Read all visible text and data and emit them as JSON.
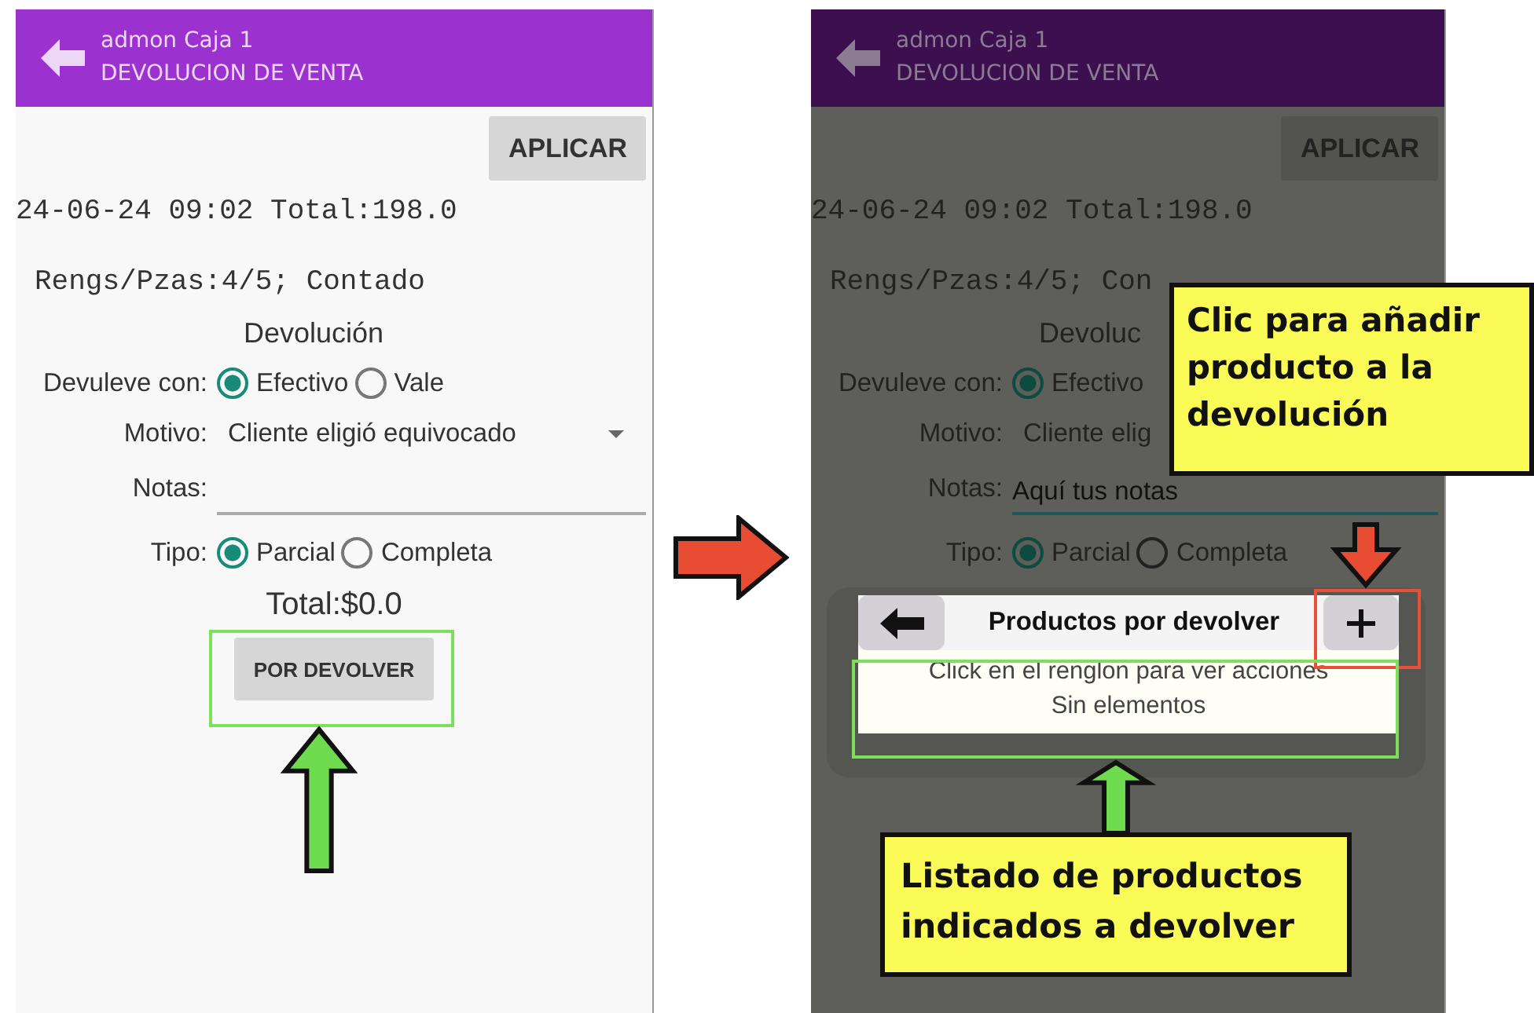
{
  "screens": [
    {
      "dimmed": false,
      "app_bar": {
        "subtitle": "admon Caja 1",
        "title": "DEVOLUCION DE VENTA"
      },
      "apply_button": "APLICAR",
      "sale_line": "24-06-24 09:02 Total:198.0",
      "items_line": "Rengs/Pzas:4/5; Contado",
      "section_title": "Devolución",
      "refund_with": {
        "label": "Devuleve con:",
        "options": [
          {
            "label": "Efectivo",
            "selected": true
          },
          {
            "label": "Vale",
            "selected": false
          }
        ]
      },
      "reason": {
        "label": "Motivo:",
        "value": "Cliente eligió equivocado",
        "caret": true
      },
      "notes": {
        "label": "Notas:",
        "focused": false
      },
      "type": {
        "label": "Tipo:",
        "options": [
          {
            "label": "Parcial",
            "selected": true
          },
          {
            "label": "Completa",
            "selected": false
          }
        ]
      },
      "total": "Total:$0.0",
      "pending_button": "POR DEVOLVER"
    },
    {
      "dimmed": true,
      "app_bar": {
        "subtitle": "admon Caja 1",
        "title": "DEVOLUCION DE VENTA"
      },
      "apply_button": "APLICAR",
      "sale_line": "24-06-24 09:02 Total:198.0",
      "items_line": "Rengs/Pzas:4/5; Con",
      "section_title": "Devoluc",
      "refund_with": {
        "label": "Devuleve con:",
        "options": [
          {
            "label": "Efectivo",
            "selected": true
          }
        ]
      },
      "reason": {
        "label": "Motivo:",
        "value": "Cliente elig"
      },
      "notes": {
        "label": "Notas:",
        "value": "Aquí tus notas",
        "focused": true
      },
      "type": {
        "label": "Tipo:",
        "options": [
          {
            "label": "Parcial",
            "selected": true
          },
          {
            "label": "Completa",
            "selected": false
          }
        ]
      },
      "dialog": {
        "title": "Productos por devolver",
        "hint": "Click en el renglon para ver acciones",
        "empty_text": "Sin elementos"
      }
    }
  ],
  "callouts": [
    {
      "text": "Clic para añadir producto a la devolución"
    },
    {
      "text": "Listado de productos indicados a devolver"
    }
  ]
}
